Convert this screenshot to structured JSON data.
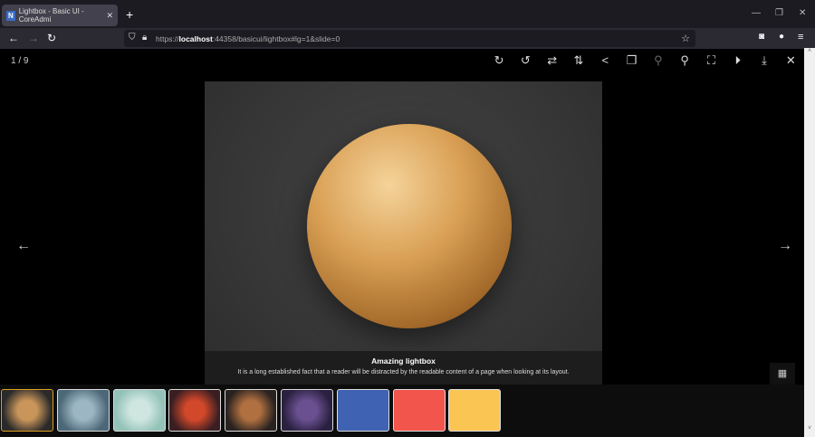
{
  "browser": {
    "tab_title": "Lightbox - Basic UI - CoreAdmi",
    "tab_favicon": "N",
    "url_prefix": "https://",
    "url_host": "localhost",
    "url_rest": ":44358/basicui/lightbox#lg=1&slide=0"
  },
  "lightbox": {
    "counter": "1 / 9",
    "caption_title": "Amazing lightbox",
    "caption_text": "It is a long established fact that a reader will be distracted by the readable content of a page when looking at its layout.",
    "toolbar": [
      "rotate-right-icon",
      "rotate-left-icon",
      "flip-horizontal-icon",
      "flip-vertical-icon",
      "share-icon",
      "copy-icon",
      "zoom-out-icon",
      "zoom-in-icon",
      "fullscreen-icon",
      "play-icon",
      "download-icon",
      "close-icon"
    ],
    "thumbnails": [
      {
        "name": "sphere",
        "colors": [
          "#c9955a",
          "#2a2a2a"
        ]
      },
      {
        "name": "crater",
        "colors": [
          "#9cb6c3",
          "#4c6878"
        ]
      },
      {
        "name": "jellyfish",
        "colors": [
          "#cfe6e0",
          "#93c2b8"
        ]
      },
      {
        "name": "fire-island",
        "colors": [
          "#d2482a",
          "#3a1e22"
        ]
      },
      {
        "name": "ships",
        "colors": [
          "#b07040",
          "#2a2220"
        ]
      },
      {
        "name": "creature",
        "colors": [
          "#6a5090",
          "#2a2040"
        ]
      },
      {
        "name": "tiles",
        "colors": [
          "#3f63b2",
          "#3f63b2"
        ]
      },
      {
        "name": "logo-d",
        "colors": [
          "#f2554c",
          "#f2554c"
        ]
      },
      {
        "name": "logo-plus",
        "colors": [
          "#fbc554",
          "#fbc554"
        ]
      }
    ]
  }
}
